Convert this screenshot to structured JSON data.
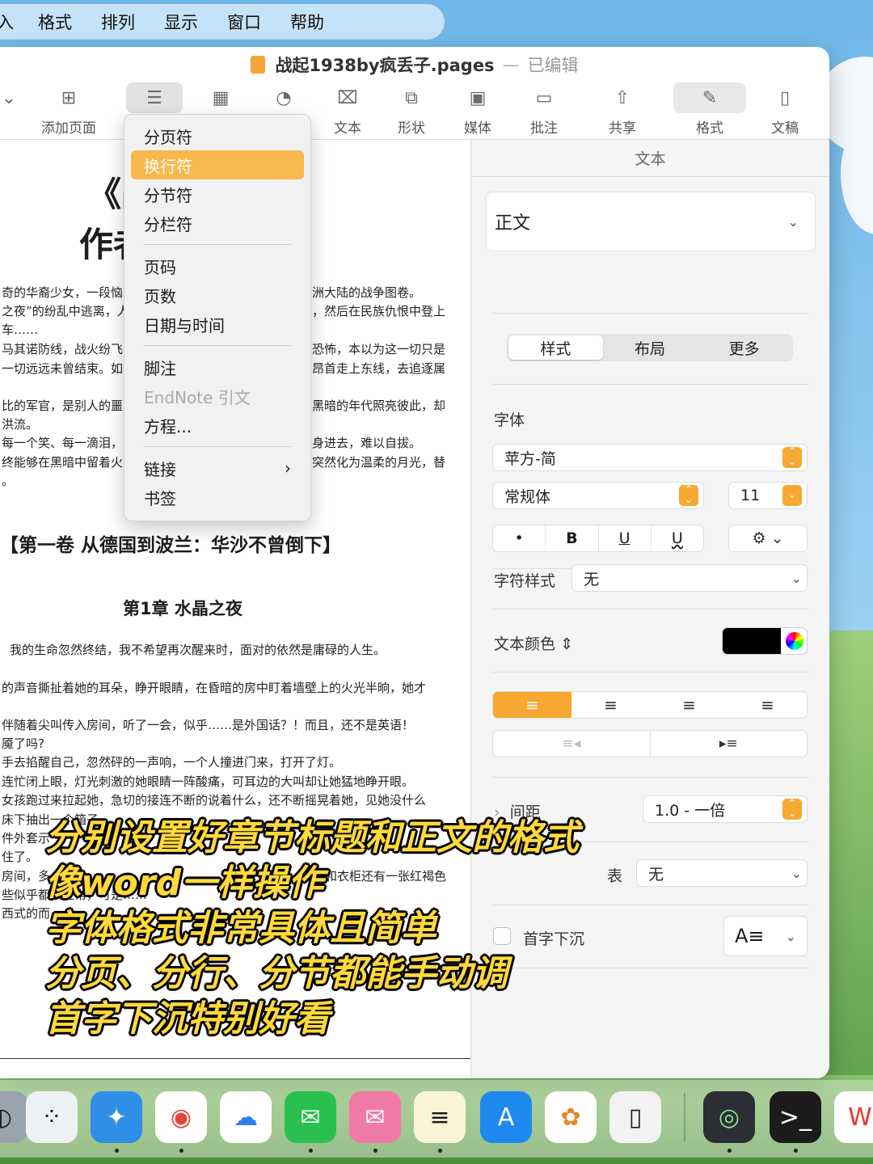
{
  "menubar": {
    "items": [
      "入",
      "格式",
      "排列",
      "显示",
      "窗口",
      "帮助"
    ]
  },
  "window": {
    "title": "战起1938by疯丢子.pages",
    "separator": "—",
    "status": "已编辑"
  },
  "toolbar": {
    "items": [
      {
        "label": "",
        "icon": "chevron-down-icon"
      },
      {
        "label": "添加页面",
        "icon": "add-page-icon"
      },
      {
        "label": "",
        "icon": "insert-icon"
      },
      {
        "label": "",
        "icon": "table-icon"
      },
      {
        "label": "",
        "icon": "chart-icon"
      },
      {
        "label": "文本",
        "icon": "text-box-icon"
      },
      {
        "label": "形状",
        "icon": "shape-icon"
      },
      {
        "label": "媒体",
        "icon": "media-icon"
      },
      {
        "label": "批注",
        "icon": "comment-icon"
      },
      {
        "label": "共享",
        "icon": "share-icon"
      },
      {
        "label": "格式",
        "icon": "format-brush-icon"
      },
      {
        "label": "文稿",
        "icon": "document-icon"
      }
    ]
  },
  "insert_menu": {
    "items": [
      {
        "label": "分页符"
      },
      {
        "label": "换行符",
        "highlighted": true
      },
      {
        "label": "分节符"
      },
      {
        "label": "分栏符"
      },
      {
        "label": "页码"
      },
      {
        "label": "页数"
      },
      {
        "label": "日期与时间"
      },
      {
        "label": "脚注"
      },
      {
        "label": "EndNote 引文",
        "disabled": true
      },
      {
        "label": "方程..."
      },
      {
        "label": "链接",
        "submenu": true
      },
      {
        "label": "书签"
      }
    ]
  },
  "document": {
    "title_line1": "《战",
    "title_line2": "作者",
    "left_lines": [
      "奇的华裔少女，一段恼",
      "之夜”的纷乱中逃离，人",
      "车……",
      "马其诺防线，战火纷飞",
      "一切远远未曾结束。如",
      "比的军官，是别人的噩",
      "洪流。",
      "每一个笑、每一滴泪，",
      "终能够在黑暗中留着火",
      "。"
    ],
    "right_lines": [
      "洲大陆的战争图卷。",
      "，然后在民族仇恨中登上",
      "恐怖，本以为这一切只是",
      "昂首走上东线，去追逐属",
      "黑暗的年代照亮彼此，却",
      "身进去，难以自拔。",
      "突然化为温柔的月光，替"
    ],
    "volume_title": "【第一卷 从德国到波兰：华沙不曾倒下】",
    "chapter_title": "第1章 水晶之夜",
    "body_lines": [
      "我的生命忽然终结，我不希望再次醒来时，面对的依然是庸碌的人生。",
      "的声音撕扯着她的耳朵，睁开眼睛，在昏暗的房中盯着墙壁上的火光半晌，她才",
      "伴随着尖叫传入房间，听了一会，似乎……是外国话？！而且，还不是英语！",
      "魇了吗?",
      "手去掐醒自己，忽然砰的一声响，一个人撞进门来，打开了灯。",
      "连忙闭上眼，灯光刺激的她眼睛一阵酸痛，可耳边的大叫却让她猛地睁开眼。",
      "女孩跑过来拉起她，急切的接连不断的说着什么，还不断摇晃着她，见她没什么",
      "床下抽出一个箱子",
      "件外套示",
      "住了。",
      "房间，多",
      "和衣柜还有一张红褐色",
      "些似乎都很正常，可是……",
      "西式的而"
    ]
  },
  "inspector": {
    "header": "文本",
    "paragraph_style": "正文",
    "tabs": [
      "样式",
      "布局",
      "更多"
    ],
    "font_label": "字体",
    "font_family": "苹方-简",
    "font_weight": "常规体",
    "font_size": "11",
    "format_buttons": [
      "•",
      "B",
      "U",
      "U"
    ],
    "char_style_label": "字符样式",
    "char_style_value": "无",
    "text_color_label": "文本颜色",
    "text_color": "#000000",
    "align_buttons": [
      "≡",
      "≡",
      "≡",
      "≡"
    ],
    "indent_buttons": [
      "≡◂",
      "▸≡"
    ],
    "spacing_label": "间距",
    "spacing_value": "1.0 - 一倍",
    "list_label": "表",
    "list_value": "无",
    "dropcap_label": "首字下沉",
    "dropcap_icon": "A≡"
  },
  "dock": {
    "apps": [
      "finder-icon",
      "launchpad-icon",
      "safari-icon",
      "chrome-icon",
      "baidu-netdisk-icon",
      "wechat-icon",
      "wechat-alt-icon",
      "notes-icon",
      "app-store-icon",
      "photos-icon",
      "iphone-mirroring-icon",
      "stats-icon",
      "terminal-icon",
      "wps-icon"
    ]
  },
  "caption": {
    "lines": [
      "分别设置好章节标题和正文的格式",
      "像word一样操作",
      "字体格式非常具体且简单",
      "分页、分行、分节都能手动调",
      "首字下沉特别好看"
    ]
  },
  "colors": {
    "accent": "#f7a830",
    "menu_highlight": "#f8b84e",
    "caption_text": "#ffd93a"
  }
}
